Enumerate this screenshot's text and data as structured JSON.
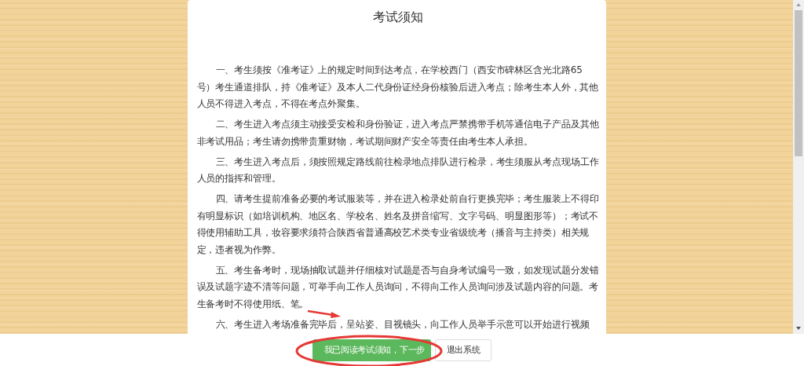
{
  "notice": {
    "title": "考试须知",
    "paragraphs": [
      "一、考生须按《准考证》上的规定时间到达考点，在学校西门（西安市碑林区含光北路65号）考生通道排队，持《准考证》及本人二代身份证经身份核验后进入考点；除考生本人外，其他人员不得进入考点，不得在考点外聚集。",
      "二、考生进入考点须主动接受安检和身份验证，进入考点严禁携带手机等通信电子产品及其他非考试用品；考生请勿携带贵重财物，考试期间财产安全等责任由考生本人承担。",
      "三、考生进入考点后，须按照规定路线前往检录地点排队进行检录，考生须服从考点现场工作人员的指挥和管理。",
      "四、请考生提前准备必要的考试服装等，并在进入检录处前自行更换完毕；考生服装上不得印有明显标识（如培训机构、地区名、学校名、姓名及拼音缩写、文字号码、明显图形等）；考试不得使用辅助工具，妆容要求须符合陕西省普通高校艺术类专业省级统考（播音与主持类）相关规定，违者视为作弊。",
      "五、考生备考时，现场抽取试题并仔细核对试题是否与自身考试编号一致，如发现试题分发错误及试题字迹不清等问题，可举手向工作人员询问，不得向工作人员询问涉及试题内容的问题。考生备考时不得使用纸、笔。",
      "六、考生进入考场准备完毕后，呈站姿、目视镜头，向工作人员举手示意可以开始进行视频"
    ]
  },
  "buttons": [
    {
      "label": "我已阅读考试须知，下一步",
      "kind": "primary"
    },
    {
      "label": "退出系统",
      "kind": "default"
    }
  ]
}
